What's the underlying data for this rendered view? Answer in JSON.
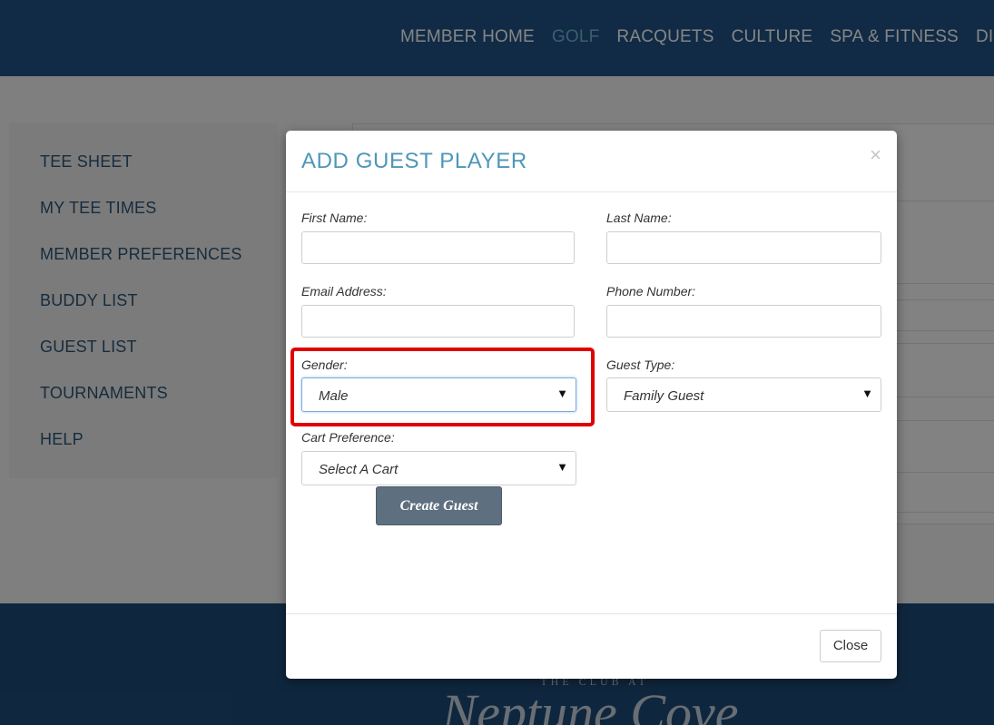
{
  "nav": {
    "items": [
      "MEMBER HOME",
      "GOLF",
      "RACQUETS",
      "CULTURE",
      "SPA & FITNESS",
      "DIN"
    ],
    "active_index": 1
  },
  "sidebar": {
    "items": [
      "TEE SHEET",
      "MY TEE TIMES",
      "MEMBER PREFERENCES",
      "BUDDY LIST",
      "GUEST LIST",
      "TOURNAMENTS",
      "HELP"
    ]
  },
  "footer": {
    "logo_text": "THE CLUB AT Neptune Cove"
  },
  "modal": {
    "title": "ADD GUEST PLAYER",
    "close_x": "×",
    "first_name_label": "First Name:",
    "first_name_value": "",
    "last_name_label": "Last Name:",
    "last_name_value": "",
    "email_label": "Email Address:",
    "email_value": "",
    "phone_label": "Phone Number:",
    "phone_value": "",
    "gender_label": "Gender:",
    "gender_value": "Male",
    "guest_type_label": "Guest Type:",
    "guest_type_value": "Family Guest",
    "cart_label": "Cart Preference:",
    "cart_value": "Select A Cart",
    "dropdown_arrow": "▼",
    "create_button": "Create Guest",
    "close_button": "Close"
  },
  "colors": {
    "topbar": "#215487",
    "nav_active": "#6fb6cf",
    "title": "#4f97b7",
    "highlight": "#e00000",
    "create_button": "#5e6f80"
  }
}
